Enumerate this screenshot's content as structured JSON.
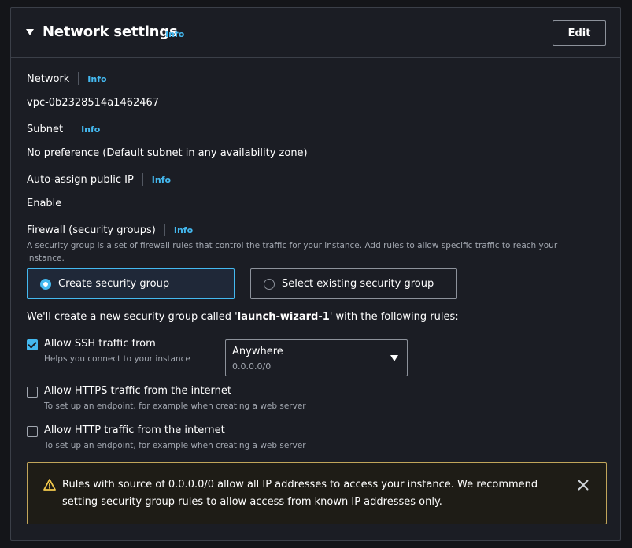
{
  "section": {
    "title": "Network settings",
    "info_label": "Info",
    "edit_label": "Edit"
  },
  "network": {
    "label": "Network",
    "info": "Info",
    "value": "vpc-0b2328514a1462467"
  },
  "subnet": {
    "label": "Subnet",
    "info": "Info",
    "value": "No preference (Default subnet in any availability zone)"
  },
  "auto_ip": {
    "label": "Auto-assign public IP",
    "info": "Info",
    "value": "Enable"
  },
  "firewall": {
    "label": "Firewall (security groups)",
    "info": "Info",
    "description": "A security group is a set of firewall rules that control the traffic for your instance. Add rules to allow specific traffic to reach your instance.",
    "options": [
      {
        "label": "Create security group",
        "selected": true
      },
      {
        "label": "Select existing security group",
        "selected": false
      }
    ],
    "intro_prefix": "We'll create a new security group called '",
    "group_name": "launch-wizard-1",
    "intro_suffix": "' with the following rules:"
  },
  "rules": [
    {
      "label": "Allow SSH traffic from",
      "hint": "Helps you connect to your instance",
      "checked": true
    },
    {
      "label": "Allow HTTPS traffic from the internet",
      "hint": "To set up an endpoint, for example when creating a web server",
      "checked": false
    },
    {
      "label": "Allow HTTP traffic from the internet",
      "hint": "To set up an endpoint, for example when creating a web server",
      "checked": false
    }
  ],
  "ssh_source": {
    "selected": "Anywhere",
    "sub": "0.0.0.0/0"
  },
  "warning": {
    "text": "Rules with source of 0.0.0.0/0 allow all IP addresses to access your instance. We recommend setting security group rules to allow access from known IP addresses only."
  },
  "colors": {
    "accent": "#44b9f0",
    "warning_border": "#c1a55a",
    "background": "#1b1d24"
  }
}
